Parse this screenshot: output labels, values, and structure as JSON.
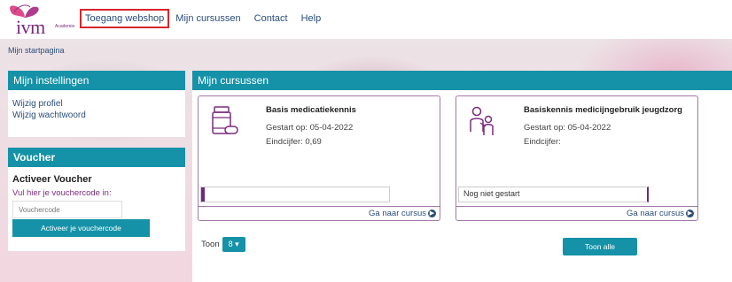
{
  "brand": {
    "logo_text": "ivm",
    "logo_sub": "Academie",
    "accent": "#1592a8",
    "purple": "#7a2b7e"
  },
  "nav": [
    {
      "label": "Toegang webshop"
    },
    {
      "label": "Mijn cursussen"
    },
    {
      "label": "Contact"
    },
    {
      "label": "Help"
    }
  ],
  "breadcrumb": "Mijn startpagina",
  "settings": {
    "title": "Mijn instellingen",
    "links": [
      "Wijzig profiel",
      "Wijzig wachtwoord"
    ]
  },
  "voucher": {
    "title": "Voucher",
    "heading": "Activeer Voucher",
    "hint": "Vul hier je vouchercode in:",
    "placeholder": "Vouchercode",
    "button": "Activeer je vouchercode"
  },
  "courses": {
    "title": "Mijn cursussen",
    "items": [
      {
        "title": "Basis medicatiekennis",
        "started": "Gestart op: 05-04-2022",
        "grade": "Eindcijfer: 0,69",
        "progress": 0.02,
        "status_text": "",
        "link": "Ga naar cursus",
        "icon": "medicine-bottle-icon"
      },
      {
        "title": "Basiskennis medicijngebruik jeugdzorg",
        "started": "Gestart op: 05-04-2022",
        "grade": "Eindcijfer:",
        "progress": 0,
        "status_text": "Nog niet gestart",
        "link": "Ga naar cursus",
        "icon": "caregiver-child-icon"
      }
    ],
    "show_label": "Toon",
    "show_value": "8",
    "show_all": "Toon alle"
  }
}
